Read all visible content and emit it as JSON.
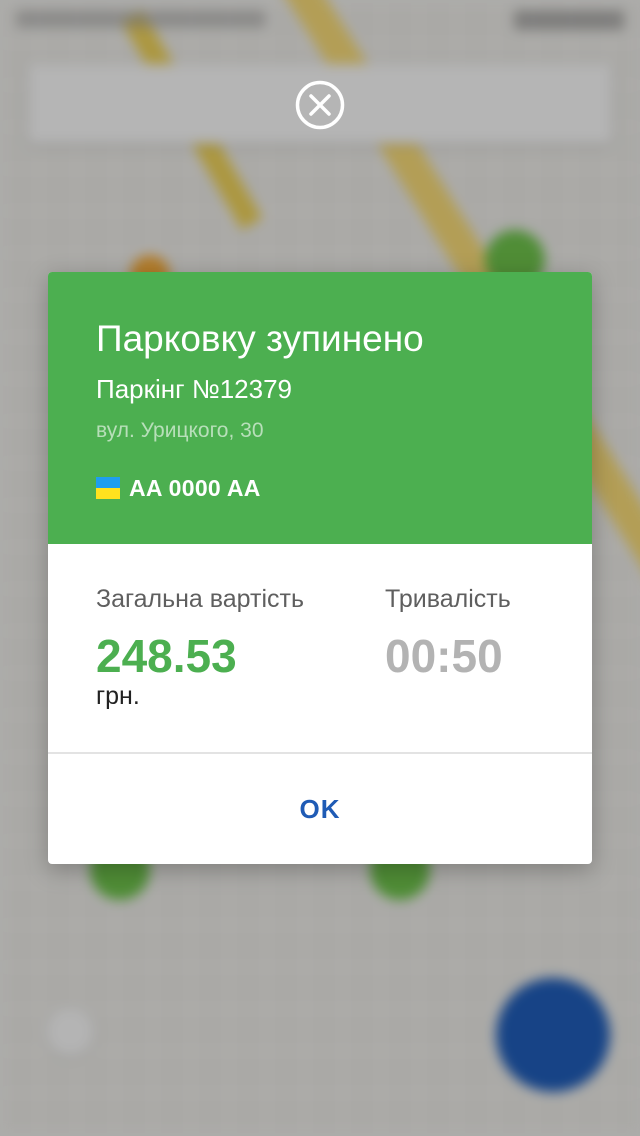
{
  "dialog": {
    "title": "Парковку зупинено",
    "parking_name": "Паркінг №12379",
    "parking_address": "вул. Урицкого, 30",
    "plate_number": "AA 0000 AA",
    "flag": {
      "icon": "ukraine-flag-icon",
      "colors": [
        "#1e9ef0",
        "#ffe21e"
      ]
    },
    "total_label": "Загальна вартість",
    "total_value": "248.53",
    "currency": "грн.",
    "duration_label": "Тривалість",
    "duration_value": "00:50",
    "ok_label": "OK"
  },
  "close_button": {
    "icon": "close-circle-icon"
  },
  "colors": {
    "accent_green": "#4caf50",
    "button_blue": "#1f5bb5",
    "muted_gray": "#b3b3b3"
  }
}
